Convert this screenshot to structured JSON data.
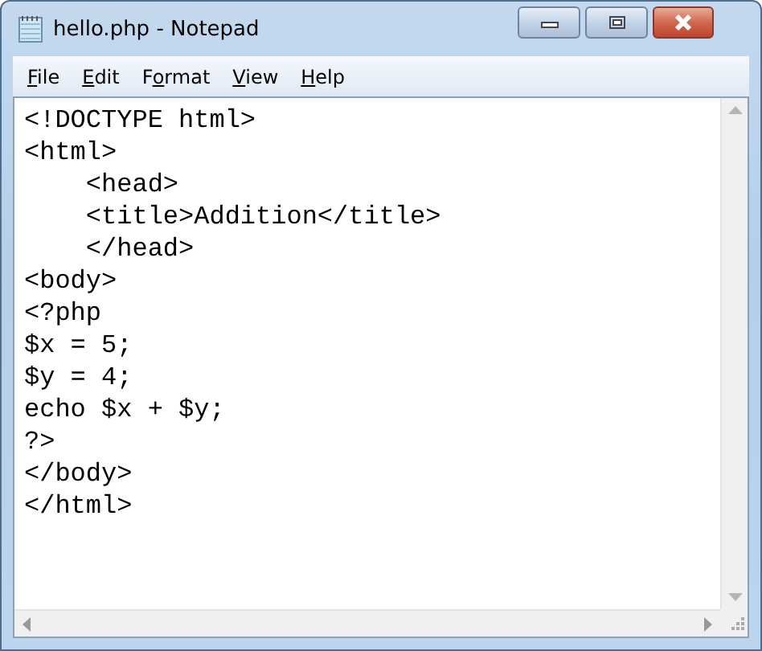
{
  "window": {
    "title": "hello.php - Notepad"
  },
  "menu": [
    {
      "access_key": "F",
      "label_after": "ile"
    },
    {
      "access_key": "E",
      "label_after": "dit"
    },
    {
      "label_before": "F",
      "access_key": "o",
      "label_after": "rmat"
    },
    {
      "access_key": "V",
      "label_after": "iew"
    },
    {
      "access_key": "H",
      "label_after": "elp"
    }
  ],
  "editor": {
    "lines": [
      "<!DOCTYPE html>",
      "<html>",
      "    <head>",
      "    <title>Addition</title>",
      "    </head>",
      "<body>",
      "<?php",
      "$x = 5;",
      "$y = 4;",
      "echo $x + $y;",
      "?>",
      "</body>",
      "</html>"
    ]
  }
}
